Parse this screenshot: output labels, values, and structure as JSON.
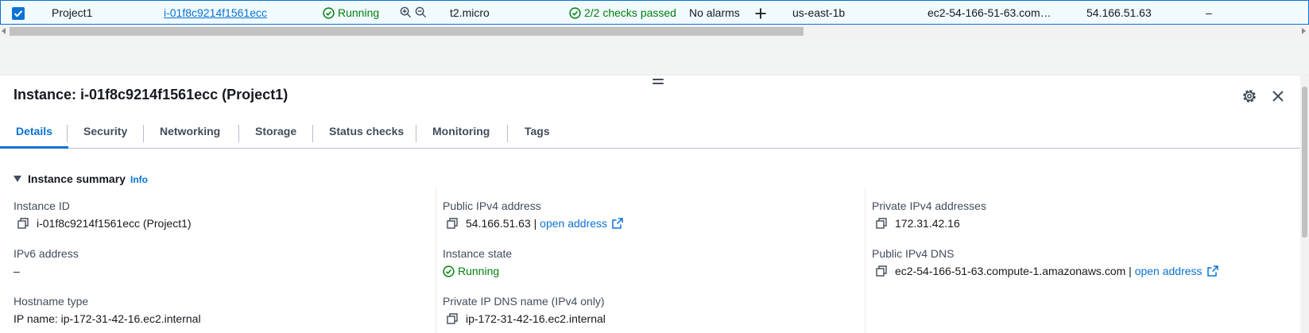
{
  "row": {
    "selected": true,
    "name": "Project1",
    "instance_id": "i-01f8c9214f1561ecc",
    "state": "Running",
    "type": "t2.micro",
    "checks": "2/2 checks passed",
    "alarms": "No alarms",
    "az": "us-east-1b",
    "public_dns": "ec2-54-166-51-63.com…",
    "public_ip": "54.166.51.63",
    "extra": "–"
  },
  "panel": {
    "title": "Instance: i-01f8c9214f1561ecc (Project1)",
    "tabs": [
      {
        "label": "Details",
        "active": true
      },
      {
        "label": "Security"
      },
      {
        "label": "Networking"
      },
      {
        "label": "Storage"
      },
      {
        "label": "Status checks"
      },
      {
        "label": "Monitoring"
      },
      {
        "label": "Tags"
      }
    ],
    "summary": {
      "heading": "Instance summary",
      "info": "Info",
      "instance_id": {
        "label": "Instance ID",
        "value": "i-01f8c9214f1561ecc (Project1)"
      },
      "ipv6": {
        "label": "IPv6 address",
        "value": "–"
      },
      "hostname_type": {
        "label": "Hostname type",
        "value": "IP name: ip-172-31-42-16.ec2.internal"
      },
      "public_ipv4": {
        "label": "Public IPv4 address",
        "value": "54.166.51.63",
        "sep": "|",
        "link": "open address"
      },
      "instance_state": {
        "label": "Instance state",
        "value": "Running"
      },
      "private_dns": {
        "label": "Private IP DNS name (IPv4 only)",
        "value": "ip-172-31-42-16.ec2.internal"
      },
      "private_ipv4": {
        "label": "Private IPv4 addresses",
        "value": "172.31.42.16"
      },
      "public_dns": {
        "label": "Public IPv4 DNS",
        "value": "ec2-54-166-51-63.compute-1.amazonaws.com",
        "sep": "|",
        "link": "open address"
      }
    }
  },
  "colors": {
    "accent": "#0972d3",
    "success": "#037f0c",
    "selected_row_bg": "#f1faff",
    "text": "#16191f"
  },
  "icons": [
    "checkbox-checked-icon",
    "status-success-icon",
    "zoom-in-icon",
    "zoom-out-icon",
    "plus-icon",
    "copy-icon",
    "external-link-icon",
    "settings-icon",
    "close-icon",
    "drag-handle-icon",
    "caret-down-icon"
  ]
}
